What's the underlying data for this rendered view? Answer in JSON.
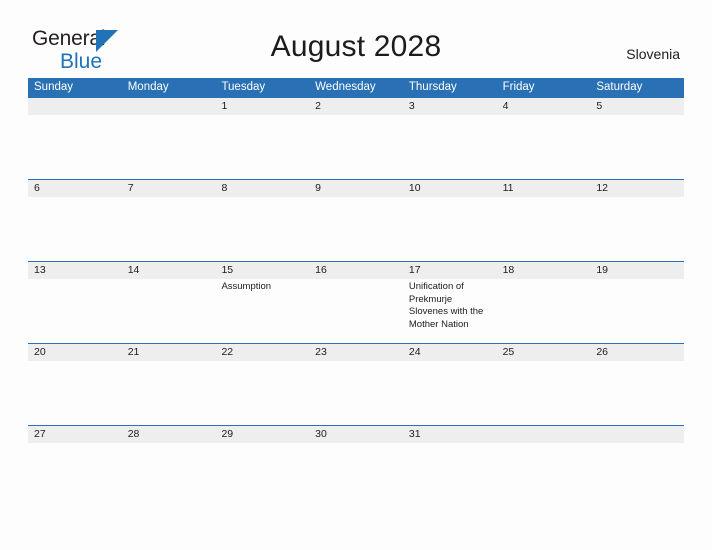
{
  "brand": {
    "name_part1": "General",
    "name_part2": "Blue",
    "triangle_icon": "triangle-icon",
    "accent_color": "#2272b8"
  },
  "header": {
    "title": "August 2028",
    "country": "Slovenia"
  },
  "calendar": {
    "month": "August",
    "year": "2028",
    "header_color": "#2a70b4",
    "date_band_color": "#eeeeee",
    "weekdays": [
      "Sunday",
      "Monday",
      "Tuesday",
      "Wednesday",
      "Thursday",
      "Friday",
      "Saturday"
    ],
    "weeks": [
      [
        {
          "date": "",
          "event": ""
        },
        {
          "date": "",
          "event": ""
        },
        {
          "date": "1",
          "event": ""
        },
        {
          "date": "2",
          "event": ""
        },
        {
          "date": "3",
          "event": ""
        },
        {
          "date": "4",
          "event": ""
        },
        {
          "date": "5",
          "event": ""
        }
      ],
      [
        {
          "date": "6",
          "event": ""
        },
        {
          "date": "7",
          "event": ""
        },
        {
          "date": "8",
          "event": ""
        },
        {
          "date": "9",
          "event": ""
        },
        {
          "date": "10",
          "event": ""
        },
        {
          "date": "11",
          "event": ""
        },
        {
          "date": "12",
          "event": ""
        }
      ],
      [
        {
          "date": "13",
          "event": ""
        },
        {
          "date": "14",
          "event": ""
        },
        {
          "date": "15",
          "event": "Assumption"
        },
        {
          "date": "16",
          "event": ""
        },
        {
          "date": "17",
          "event": "Unification of Prekmurje Slovenes with the Mother Nation"
        },
        {
          "date": "18",
          "event": ""
        },
        {
          "date": "19",
          "event": ""
        }
      ],
      [
        {
          "date": "20",
          "event": ""
        },
        {
          "date": "21",
          "event": ""
        },
        {
          "date": "22",
          "event": ""
        },
        {
          "date": "23",
          "event": ""
        },
        {
          "date": "24",
          "event": ""
        },
        {
          "date": "25",
          "event": ""
        },
        {
          "date": "26",
          "event": ""
        }
      ],
      [
        {
          "date": "27",
          "event": ""
        },
        {
          "date": "28",
          "event": ""
        },
        {
          "date": "29",
          "event": ""
        },
        {
          "date": "30",
          "event": ""
        },
        {
          "date": "31",
          "event": ""
        },
        {
          "date": "",
          "event": ""
        },
        {
          "date": "",
          "event": ""
        }
      ]
    ]
  }
}
